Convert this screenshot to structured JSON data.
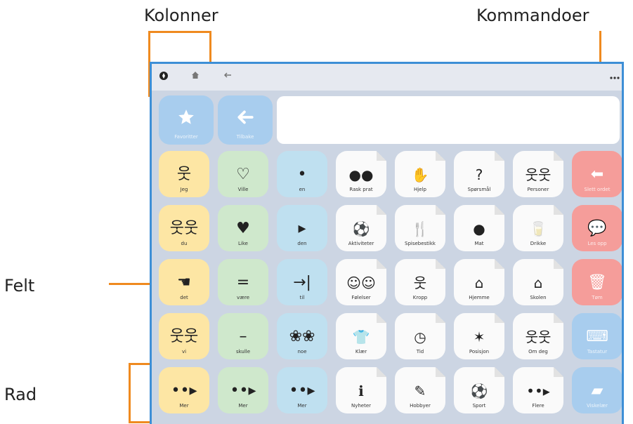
{
  "annotations": {
    "kolonner": "Kolonner",
    "kommandoer": "Kommandoer",
    "felt": "Felt",
    "rad": "Rad"
  },
  "topbar": {
    "compass_icon": "compass-icon",
    "home_icon": "home-icon",
    "back_icon": "back-arrow-icon",
    "more_icon": "more-icon"
  },
  "nav_buttons": [
    {
      "label": "Favoritter",
      "icon": "star-icon"
    },
    {
      "label": "Tilbake",
      "icon": "arrow-left-icon"
    }
  ],
  "grid": {
    "rows": [
      [
        {
          "label": "Jeg",
          "icon": "stick-figure-icon",
          "color": "yellow"
        },
        {
          "label": "Ville",
          "icon": "wish-heart-icon",
          "color": "green"
        },
        {
          "label": "en",
          "icon": "dot-icon",
          "color": "blue"
        },
        {
          "label": "Rask prat",
          "icon": "speech-bubbles-icon",
          "color": "white"
        },
        {
          "label": "Hjelp",
          "icon": "help-people-icon",
          "color": "white"
        },
        {
          "label": "Spørsmål",
          "icon": "question-icon",
          "color": "white"
        },
        {
          "label": "Personer",
          "icon": "group-people-icon",
          "color": "white"
        },
        {
          "label": "Slett ordet",
          "icon": "delete-word-icon",
          "color": "cmdred"
        }
      ],
      [
        {
          "label": "du",
          "icon": "two-figures-icon",
          "color": "yellow"
        },
        {
          "label": "Like",
          "icon": "heart-icon",
          "color": "green"
        },
        {
          "label": "den",
          "icon": "arrow-right-icon",
          "color": "blue"
        },
        {
          "label": "Aktiviteter",
          "icon": "activity-icon",
          "color": "white"
        },
        {
          "label": "Spisebestikk",
          "icon": "fork-icon",
          "color": "white"
        },
        {
          "label": "Mat",
          "icon": "food-icon",
          "color": "white"
        },
        {
          "label": "Drikke",
          "icon": "glass-icon",
          "color": "white"
        },
        {
          "label": "Les opp",
          "icon": "speak-bubble-icon",
          "color": "cmdred"
        }
      ],
      [
        {
          "label": "det",
          "icon": "pointing-icon",
          "color": "yellow"
        },
        {
          "label": "være",
          "icon": "equals-icon",
          "color": "green"
        },
        {
          "label": "til",
          "icon": "arrow-to-line-icon",
          "color": "blue"
        },
        {
          "label": "Følelser",
          "icon": "faces-icon",
          "color": "white"
        },
        {
          "label": "Kropp",
          "icon": "body-icon",
          "color": "white"
        },
        {
          "label": "Hjemme",
          "icon": "home-picture-icon",
          "color": "white"
        },
        {
          "label": "Skolen",
          "icon": "school-icon",
          "color": "white"
        },
        {
          "label": "Tøm",
          "icon": "trash-icon",
          "color": "cmdred"
        }
      ],
      [
        {
          "label": "vi",
          "icon": "group-figure-icon",
          "color": "yellow"
        },
        {
          "label": "skulle",
          "icon": "minus-icon",
          "color": "green"
        },
        {
          "label": "noe",
          "icon": "things-icon",
          "color": "blue"
        },
        {
          "label": "Klær",
          "icon": "clothes-icon",
          "color": "white"
        },
        {
          "label": "Tid",
          "icon": "clock-icon",
          "color": "white"
        },
        {
          "label": "Posisjon",
          "icon": "position-icon",
          "color": "white"
        },
        {
          "label": "Om deg",
          "icon": "about-you-icon",
          "color": "white"
        },
        {
          "label": "Tastatur",
          "icon": "keyboard-icon",
          "color": "cmdblue"
        }
      ],
      [
        {
          "label": "Mer",
          "icon": "more-arrow-icon",
          "color": "yellow"
        },
        {
          "label": "Mer",
          "icon": "more-arrow-icon",
          "color": "green"
        },
        {
          "label": "Mer",
          "icon": "more-arrow-icon",
          "color": "blue"
        },
        {
          "label": "Nyheter",
          "icon": "news-icon",
          "color": "white"
        },
        {
          "label": "Hobbyer",
          "icon": "hobby-icon",
          "color": "white"
        },
        {
          "label": "Sport",
          "icon": "sport-icon",
          "color": "white"
        },
        {
          "label": "Flere",
          "icon": "more-arrow-icon",
          "color": "white"
        },
        {
          "label": "Viskelær",
          "icon": "eraser-icon",
          "color": "cmdblue"
        }
      ]
    ]
  },
  "colors": {
    "accent": "#ef8a1f",
    "frame_border": "#3d8fd6",
    "background": "#ccd5e3"
  }
}
